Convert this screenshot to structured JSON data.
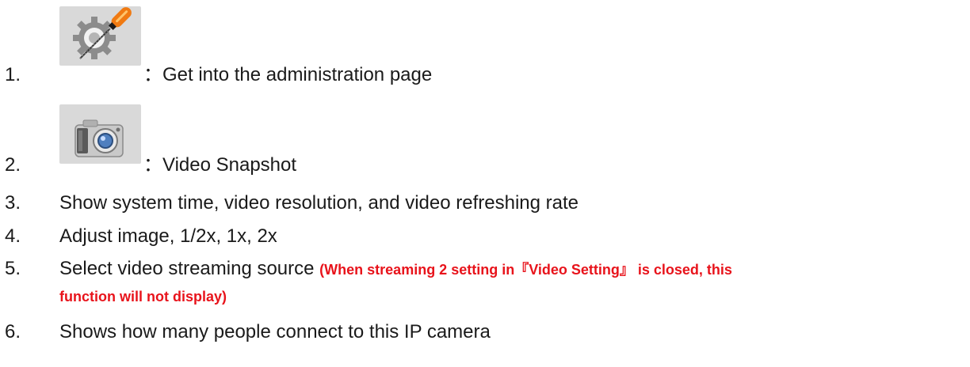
{
  "items": [
    {
      "number": "1.",
      "icon": "gear-wrench-icon",
      "text": "：Get into the administration page"
    },
    {
      "number": "2.",
      "icon": "camera-icon",
      "text": "：Video Snapshot"
    },
    {
      "number": "3.",
      "text": "Show system time, video resolution, and video refreshing rate"
    },
    {
      "number": "4.",
      "text": "Adjust image, 1/2x, 1x, 2x"
    },
    {
      "number": "5.",
      "text": "Select video streaming source",
      "note_line1": "(When streaming 2 setting in『Video Setting』 is closed, this",
      "note_line2": "function will not display)"
    },
    {
      "number": "6.",
      "text": "Shows how many people connect to this IP camera"
    }
  ],
  "colors": {
    "note": "#e8131b",
    "icon_background": "#d9d9d9",
    "text": "#1a1a1a"
  }
}
